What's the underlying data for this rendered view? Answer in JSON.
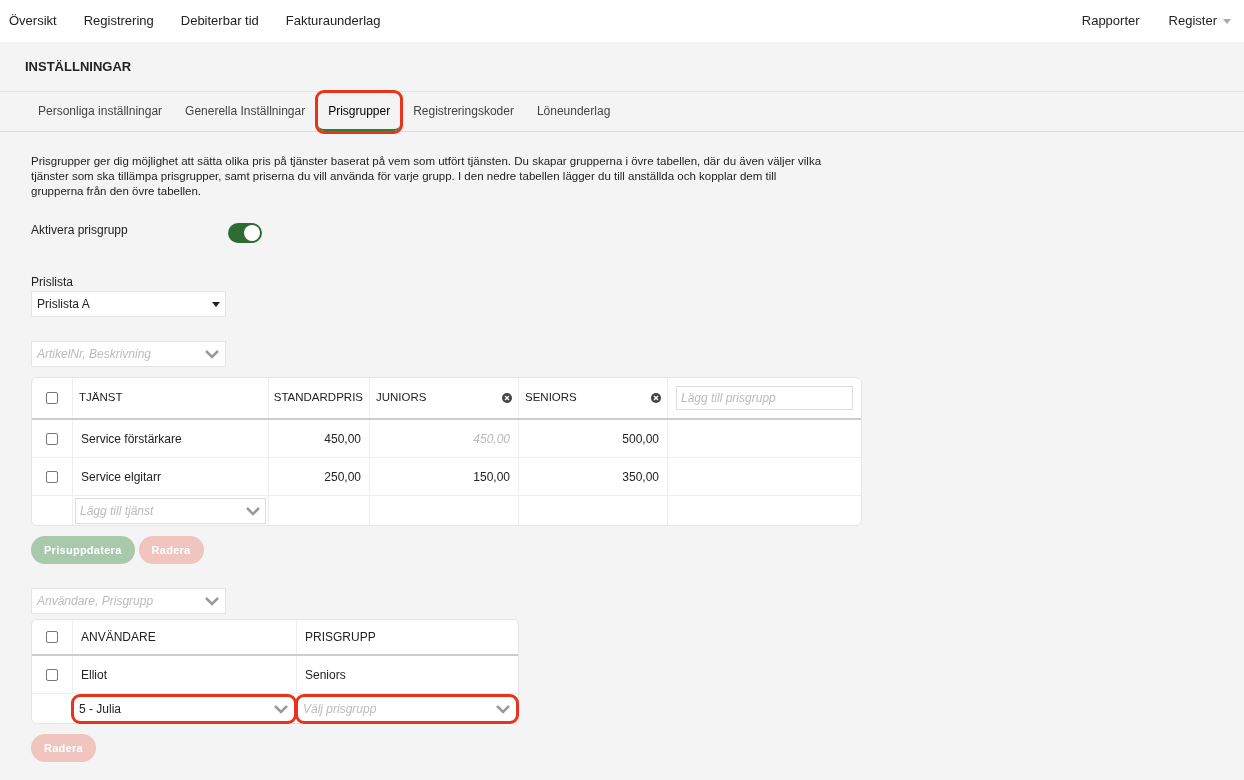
{
  "nav": {
    "left": [
      "Översikt",
      "Registrering",
      "Debiterbar tid",
      "Fakturaunderlag"
    ],
    "right": [
      {
        "label": "Rapporter",
        "dropdown": false
      },
      {
        "label": "Register",
        "dropdown": true
      }
    ]
  },
  "page_title": "INSTÄLLNINGAR",
  "tabs": [
    {
      "label": "Personliga inställningar",
      "selected": false,
      "highlighted": false
    },
    {
      "label": "Generella Inställningar",
      "selected": false,
      "highlighted": false
    },
    {
      "label": "Prisgrupper",
      "selected": true,
      "highlighted": true
    },
    {
      "label": "Registreringskoder",
      "selected": false,
      "highlighted": false
    },
    {
      "label": "Löneunderlag",
      "selected": false,
      "highlighted": false
    }
  ],
  "description": "Prisgrupper ger dig möjlighet att sätta olika pris på tjänster baserat på vem som utfört tjänsten. Du skapar grupperna i övre tabellen, där du även väljer vilka tjänster som ska tillämpa prisgrupper, samt priserna du vill använda för varje grupp. I den nedre tabellen lägger du till anställda och kopplar dem till grupperna från den övre tabellen.",
  "toggle": {
    "label": "Aktivera prisgrupp",
    "on": true
  },
  "price_list": {
    "label": "Prislista",
    "value": "Prislista A"
  },
  "service_filter": {
    "placeholder": "ArtikelNr, Beskrivning"
  },
  "services_table": {
    "select_all_checked": false,
    "columns": [
      {
        "label": "TJÄNST",
        "removable": false
      },
      {
        "label": "STANDARDPRIS",
        "removable": false
      },
      {
        "label": "JUNIORS",
        "removable": true
      },
      {
        "label": "SENIORS",
        "removable": true
      }
    ],
    "add_group": {
      "placeholder": "Lägg till prisgrupp"
    },
    "rows": [
      {
        "checked": false,
        "cells": [
          {
            "text": "Service förstärkare",
            "kind": "value"
          },
          {
            "text": "450,00",
            "kind": "value"
          },
          {
            "text": "450,00",
            "kind": "placeholder"
          },
          {
            "text": "500,00",
            "kind": "value"
          }
        ]
      },
      {
        "checked": false,
        "cells": [
          {
            "text": "Service elgitarr",
            "kind": "value"
          },
          {
            "text": "250,00",
            "kind": "value"
          },
          {
            "text": "150,00",
            "kind": "value"
          },
          {
            "text": "350,00",
            "kind": "value"
          }
        ]
      }
    ],
    "add_service": {
      "placeholder": "Lägg till tjänst"
    }
  },
  "services_buttons": [
    {
      "label": "Prisuppdatera",
      "kind": "primary",
      "disabled": true
    },
    {
      "label": "Radera",
      "kind": "danger",
      "disabled": true
    }
  ],
  "user_filter": {
    "placeholder": "Användare, Prisgrupp"
  },
  "users_table": {
    "select_all_checked": false,
    "columns": [
      "ANVÄNDARE",
      "PRISGRUPP"
    ],
    "rows": [
      {
        "checked": false,
        "user": "Elliot",
        "group": "Seniors"
      }
    ],
    "new_row": {
      "user": {
        "value": "5 - Julia",
        "highlighted": true
      },
      "group": {
        "placeholder": "Välj prisgrupp",
        "highlighted": true
      }
    }
  },
  "users_buttons": [
    {
      "label": "Radera",
      "kind": "danger",
      "disabled": true
    }
  ]
}
